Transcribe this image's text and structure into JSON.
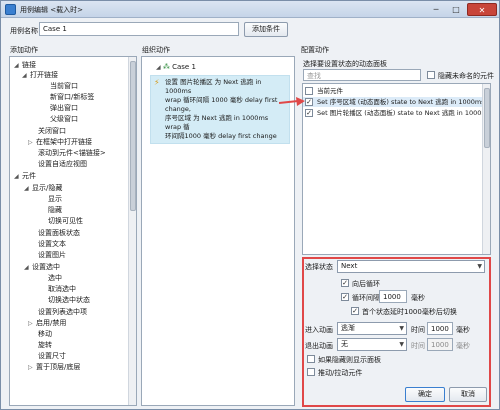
{
  "window": {
    "title": "用例编辑 <载入时>",
    "minimize": "─",
    "maximize": "□",
    "close": "✕"
  },
  "case": {
    "label": "用例名称",
    "value": "Case 1",
    "add_condition": "添加条件"
  },
  "left": {
    "title": "添加动作",
    "items": [
      "链接",
      "打开链接",
      "当前窗口",
      "新窗口/新标签",
      "弹出窗口",
      "父级窗口",
      "关闭窗口",
      "在框架中打开链接",
      "滚动到元件<锚链接>",
      "设置自适应视图",
      "元件",
      "显示/隐藏",
      "显示",
      "隐藏",
      "切换可见性",
      "设置面板状态",
      "设置文本",
      "设置图片",
      "设置选中",
      "选中",
      "取消选中",
      "切换选中状态",
      "设置列表选中项",
      "启用/禁用",
      "移动",
      "旋转",
      "设置尺寸",
      "置于顶层/底层"
    ]
  },
  "middle": {
    "title": "组织动作",
    "case_node": "Case 1",
    "action_lines": [
      "设置 图片轮播区 为 Next 逃跑 in 1000ms",
      "wrap 循环间隔 1000 毫秒 delay first",
      "change,",
      "序号区域 为 Next 逃跑 in 1000ms wrap 循",
      "环间隔1000 毫秒 delay first change"
    ]
  },
  "right": {
    "title": "配置动作",
    "subtitle": "选择要设置状态的动态面板",
    "search_placeholder": "查找",
    "hide_unnamed": "隐藏未命名的元件",
    "list": [
      "当前元件",
      "Set 序号区域 (动态面板) state to Next 逃跑 in 1000ms wrap",
      "Set 图片轮播区 (动态面板) state to Next 逃跑 in 1000ms wrap"
    ],
    "select_state_label": "选择状态",
    "select_state_value": "Next",
    "loop_back": "向后循环",
    "loop_interval": "循环间隔",
    "interval_value": "1000",
    "ms": "毫秒",
    "first_delay": "首个状态延时1000毫秒后切换",
    "enter_anim_label": "进入动画",
    "enter_anim_value": "逃渐",
    "time_label": "时间",
    "enter_time": "1000",
    "exit_anim_label": "退出动画",
    "exit_anim_value": "无",
    "exit_time": "1000",
    "show_if_hidden": "如果隐藏则显示面板",
    "push_pull": "推动/拉动元件",
    "ok": "确定",
    "cancel": "取消"
  },
  "colors": {
    "accent_red": "#e04848",
    "selection": "#d4ecf6"
  }
}
